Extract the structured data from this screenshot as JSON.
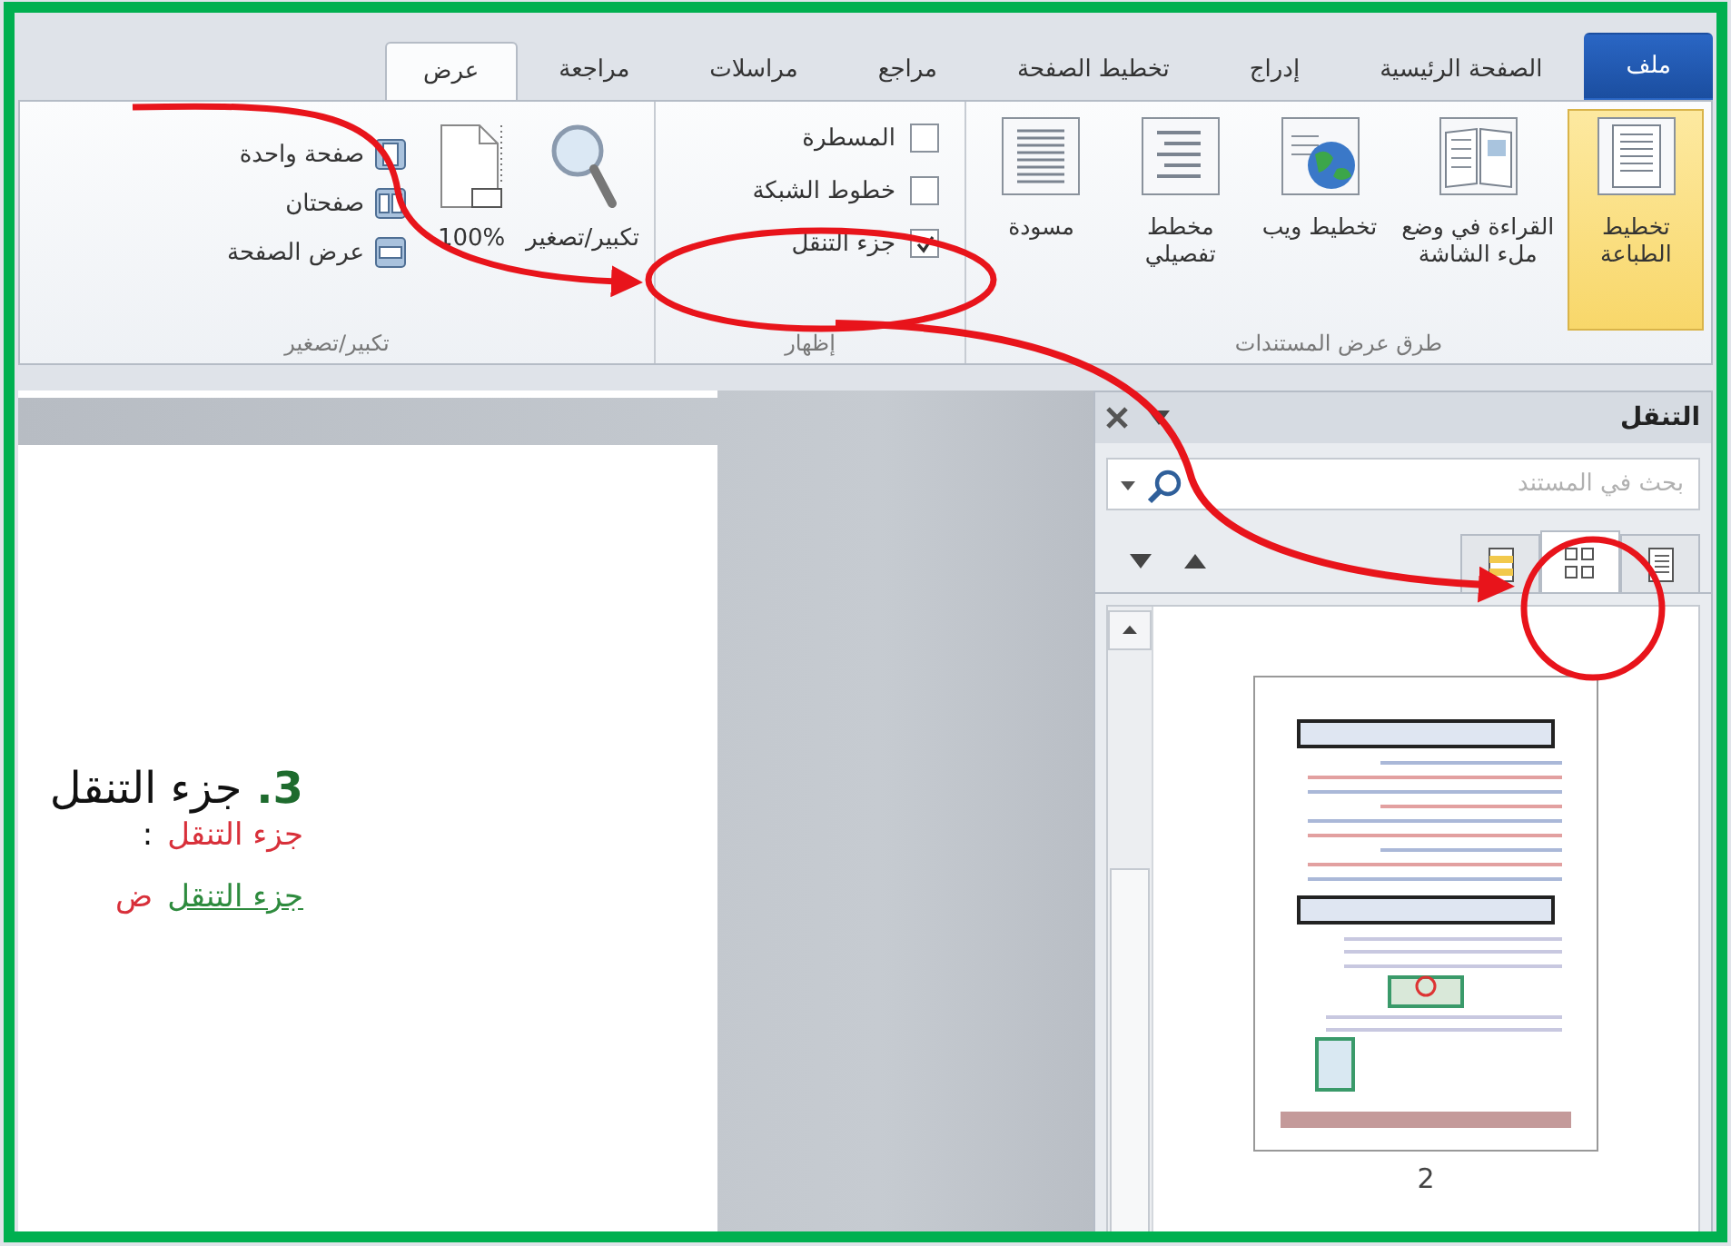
{
  "tabs": [
    {
      "label": "ملف",
      "kind": "file",
      "selected": false
    },
    {
      "label": "الصفحة الرئيسية",
      "kind": "tab",
      "selected": false
    },
    {
      "label": "إدراج",
      "kind": "tab",
      "selected": false
    },
    {
      "label": "تخطيط الصفحة",
      "kind": "tab",
      "selected": false
    },
    {
      "label": "مراجع",
      "kind": "tab",
      "selected": false
    },
    {
      "label": "مراسلات",
      "kind": "tab",
      "selected": false
    },
    {
      "label": "مراجعة",
      "kind": "tab",
      "selected": false
    },
    {
      "label": "عرض",
      "kind": "tab",
      "selected": true
    }
  ],
  "ribbon": {
    "groups": [
      {
        "title": "طرق عرض المستندات",
        "kind": "views",
        "buttons": [
          {
            "label": "تخطيط الطباعة",
            "selected": true
          },
          {
            "label": "القراءة في وضع ملء الشاشة",
            "selected": false
          },
          {
            "label": "تخطيط ويب",
            "selected": false
          },
          {
            "label": "مخطط تفصيلي",
            "selected": false
          },
          {
            "label": "مسودة",
            "selected": false
          }
        ]
      },
      {
        "title": "إظهار",
        "kind": "checks",
        "items": [
          {
            "label": "المسطرة",
            "checked": false
          },
          {
            "label": "خطوط الشبكة",
            "checked": false
          },
          {
            "label": "جزء التنقل",
            "checked": true
          }
        ]
      },
      {
        "title": "تكبير/تصغير",
        "kind": "zoom",
        "large": [
          {
            "label": "تكبير/تصغير"
          },
          {
            "label": "100%"
          }
        ],
        "small": [
          {
            "label": "صفحة واحدة"
          },
          {
            "label": "صفحتان"
          },
          {
            "label": "عرض الصفحة"
          }
        ]
      }
    ]
  },
  "document": {
    "lines": [
      {
        "kind": "heading",
        "segments": [
          {
            "text": "3.",
            "color": "#1e6b2e",
            "underline": false
          },
          {
            "text": "جزء التنقل",
            "color": "#111111",
            "underline": false
          }
        ]
      },
      {
        "kind": "text",
        "segments": [
          {
            "text": "جزء التنقل",
            "color": "#d8303a",
            "underline": false
          },
          {
            "text": ":",
            "color": "#111111",
            "underline": false
          }
        ]
      },
      {
        "kind": "text",
        "segments": [
          {
            "text": "جزء التنقل",
            "color": "#2e8b3e",
            "underline": true
          },
          {
            "text": "ض",
            "color": "#d8303a",
            "underline": false
          }
        ]
      }
    ]
  },
  "nav_pane": {
    "title": "التنقل",
    "search": {
      "placeholder": "بحث في المستند"
    },
    "view_tabs": [
      {
        "selected": false
      },
      {
        "selected": true
      },
      {
        "selected": false
      }
    ],
    "pages": [
      {
        "number": "2"
      }
    ]
  }
}
